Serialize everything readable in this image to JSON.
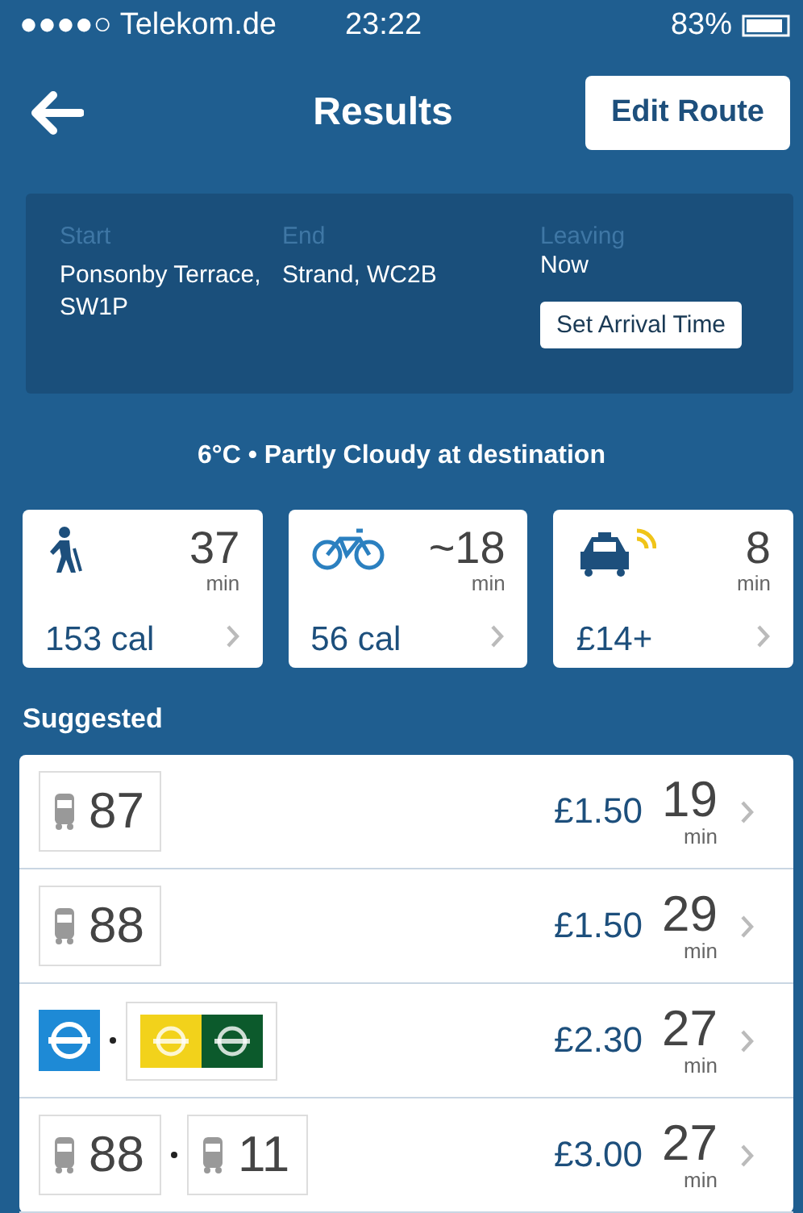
{
  "status_bar": {
    "carrier": "●●●●○ Telekom.de",
    "time": "23:22",
    "battery": "83%"
  },
  "header": {
    "title": "Results",
    "action": "Edit Route"
  },
  "journey": {
    "start_label": "Start",
    "start": "Ponsonby Terrace, SW1P",
    "end_label": "End",
    "end": "Strand, WC2B",
    "leaving_label": "Leaving",
    "leaving": "Now",
    "arrival_button": "Set Arrival Time"
  },
  "weather": "6°C • Partly Cloudy at destination",
  "modes": [
    {
      "kind": "walk",
      "duration": "37",
      "unit": "min",
      "detail": "153 cal"
    },
    {
      "kind": "bike",
      "duration": "~18",
      "unit": "min",
      "detail": "56 cal"
    },
    {
      "kind": "taxi",
      "duration": "8",
      "unit": "min",
      "detail": "£14+"
    }
  ],
  "suggested_label": "Suggested",
  "routes": [
    {
      "legs": [
        {
          "kind": "bus",
          "number": "87"
        }
      ],
      "price": "£1.50",
      "duration": "19",
      "unit": "min"
    },
    {
      "legs": [
        {
          "kind": "bus",
          "number": "88"
        }
      ],
      "price": "£1.50",
      "duration": "29",
      "unit": "min"
    },
    {
      "legs": [
        {
          "kind": "tube",
          "lines": [
            {
              "color": "#1e8ad6"
            }
          ]
        },
        {
          "kind": "tube",
          "lines": [
            {
              "color": "#f2d21b"
            },
            {
              "color": "#0c5a2c"
            }
          ]
        }
      ],
      "price": "£2.30",
      "duration": "27",
      "unit": "min"
    },
    {
      "legs": [
        {
          "kind": "bus",
          "number": "88"
        },
        {
          "kind": "bus",
          "number": "11"
        }
      ],
      "price": "£3.00",
      "duration": "27",
      "unit": "min"
    }
  ]
}
